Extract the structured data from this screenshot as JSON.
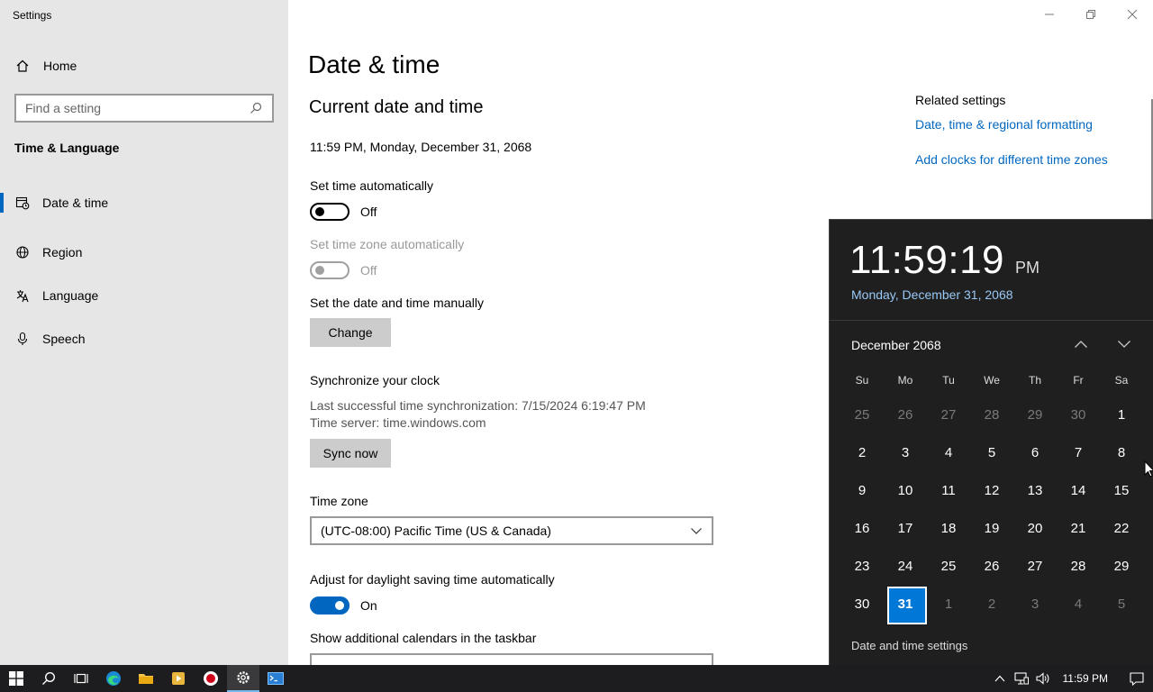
{
  "window": {
    "title": "Settings"
  },
  "sidebar": {
    "home_label": "Home",
    "search_placeholder": "Find a setting",
    "section_heading": "Time & Language",
    "items": [
      {
        "label": "Date & time",
        "icon": "date-time-icon",
        "active": true
      },
      {
        "label": "Region",
        "icon": "globe-icon"
      },
      {
        "label": "Language",
        "icon": "language-icon"
      },
      {
        "label": "Speech",
        "icon": "microphone-icon"
      }
    ]
  },
  "main": {
    "page_title": "Date & time",
    "section_title": "Current date and time",
    "current_datetime": "11:59 PM, Monday, December 31, 2068",
    "set_time_auto": {
      "label": "Set time automatically",
      "state": "Off"
    },
    "set_tz_auto": {
      "label": "Set time zone automatically",
      "state": "Off"
    },
    "manual": {
      "label": "Set the date and time manually",
      "button": "Change"
    },
    "sync": {
      "label": "Synchronize your clock",
      "last_sync": "Last successful time synchronization: 7/15/2024 6:19:47 PM",
      "server": "Time server: time.windows.com",
      "button": "Sync now"
    },
    "time_zone": {
      "label": "Time zone",
      "value": "(UTC-08:00) Pacific Time (US & Canada)"
    },
    "dst": {
      "label": "Adjust for daylight saving time automatically",
      "state": "On"
    },
    "calendars": {
      "label": "Show additional calendars in the taskbar"
    }
  },
  "related": {
    "heading": "Related settings",
    "links": [
      "Date, time & regional formatting",
      "Add clocks for different time zones"
    ]
  },
  "flyout": {
    "time": "11:59:19",
    "ampm": "PM",
    "date": "Monday, December 31, 2068",
    "month_label": "December 2068",
    "weekdays": [
      "Su",
      "Mo",
      "Tu",
      "We",
      "Th",
      "Fr",
      "Sa"
    ],
    "days": [
      {
        "d": "25",
        "other": true
      },
      {
        "d": "26",
        "other": true
      },
      {
        "d": "27",
        "other": true
      },
      {
        "d": "28",
        "other": true
      },
      {
        "d": "29",
        "other": true
      },
      {
        "d": "30",
        "other": true
      },
      {
        "d": "1"
      },
      {
        "d": "2"
      },
      {
        "d": "3"
      },
      {
        "d": "4"
      },
      {
        "d": "5"
      },
      {
        "d": "6"
      },
      {
        "d": "7"
      },
      {
        "d": "8"
      },
      {
        "d": "9"
      },
      {
        "d": "10"
      },
      {
        "d": "11"
      },
      {
        "d": "12"
      },
      {
        "d": "13"
      },
      {
        "d": "14"
      },
      {
        "d": "15"
      },
      {
        "d": "16"
      },
      {
        "d": "17"
      },
      {
        "d": "18"
      },
      {
        "d": "19"
      },
      {
        "d": "20"
      },
      {
        "d": "21"
      },
      {
        "d": "22"
      },
      {
        "d": "23"
      },
      {
        "d": "24"
      },
      {
        "d": "25"
      },
      {
        "d": "26"
      },
      {
        "d": "27"
      },
      {
        "d": "28"
      },
      {
        "d": "29"
      },
      {
        "d": "30"
      },
      {
        "d": "31",
        "today": true
      },
      {
        "d": "1",
        "other": true
      },
      {
        "d": "2",
        "other": true
      },
      {
        "d": "3",
        "other": true
      },
      {
        "d": "4",
        "other": true
      },
      {
        "d": "5",
        "other": true
      }
    ],
    "settings_link": "Date and time settings"
  },
  "taskbar": {
    "clock": "11:59 PM",
    "apps": [
      "start-icon",
      "search-icon",
      "task-view-icon",
      "edge-icon",
      "file-explorer-icon",
      "media-app-icon",
      "record-icon",
      "settings-app-icon",
      "terminal-app-icon"
    ]
  },
  "colors": {
    "accent": "#0067c0",
    "flyout_bg": "#1f1f1f",
    "sidebar_bg": "#e6e6e6",
    "taskbar_bg": "#1d1d1f"
  }
}
